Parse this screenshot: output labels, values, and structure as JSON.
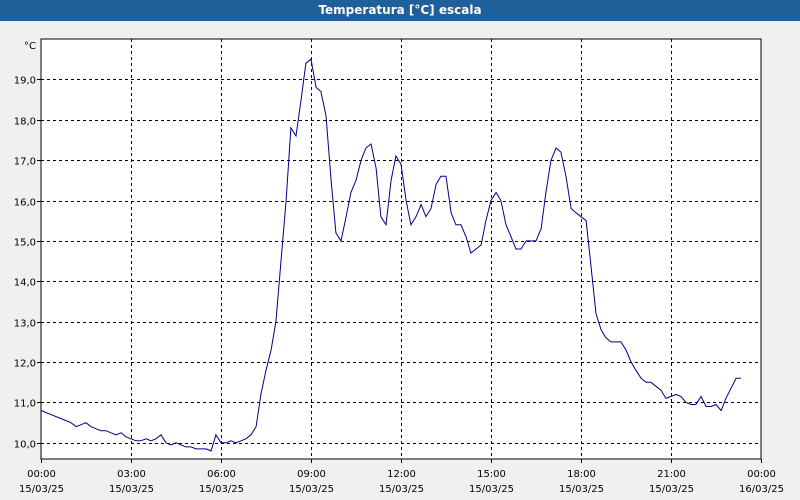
{
  "window": {
    "title": "Temperatura [°C] escala"
  },
  "colors": {
    "titlebar": "#1f5f9a",
    "line": "#00008b",
    "grid": "#000000",
    "plot_bg": "#ffffff"
  },
  "chart_data": {
    "type": "line",
    "title": "Temperatura [°C] escala",
    "ylabel": "°C",
    "xlabel": "",
    "ylim": [
      9.6,
      20.0
    ],
    "grid": true,
    "x_ticks": [
      {
        "hours": 0,
        "time": "00:00",
        "date": "15/03/25"
      },
      {
        "hours": 3,
        "time": "03:00",
        "date": "15/03/25"
      },
      {
        "hours": 6,
        "time": "06:00",
        "date": "15/03/25"
      },
      {
        "hours": 9,
        "time": "09:00",
        "date": "15/03/25"
      },
      {
        "hours": 12,
        "time": "12:00",
        "date": "15/03/25"
      },
      {
        "hours": 15,
        "time": "15:00",
        "date": "15/03/25"
      },
      {
        "hours": 18,
        "time": "18:00",
        "date": "15/03/25"
      },
      {
        "hours": 21,
        "time": "21:00",
        "date": "15/03/25"
      },
      {
        "hours": 24,
        "time": "00:00",
        "date": "16/03/25"
      }
    ],
    "y_ticks": [
      {
        "value": 10,
        "label": "10,0"
      },
      {
        "value": 11,
        "label": "11,0"
      },
      {
        "value": 12,
        "label": "12,0"
      },
      {
        "value": 13,
        "label": "13,0"
      },
      {
        "value": 14,
        "label": "14,0"
      },
      {
        "value": 15,
        "label": "15,0"
      },
      {
        "value": 16,
        "label": "16,0"
      },
      {
        "value": 17,
        "label": "17,0"
      },
      {
        "value": 18,
        "label": "18,0"
      },
      {
        "value": 19,
        "label": "19,0"
      }
    ],
    "series": [
      {
        "x_hours": [
          0,
          0.33,
          0.67,
          1.0,
          1.17,
          1.33,
          1.5,
          1.67,
          1.83,
          2.0,
          2.17,
          2.33,
          2.5,
          2.67,
          2.83,
          3.0,
          3.17,
          3.33,
          3.5,
          3.67,
          3.83,
          4.0,
          4.17,
          4.33,
          4.5,
          4.67,
          4.83,
          5.0,
          5.17,
          5.33,
          5.5,
          5.67,
          5.83,
          6.0,
          6.17,
          6.33,
          6.5,
          6.67,
          6.83,
          7.0,
          7.17,
          7.33,
          7.5,
          7.67,
          7.83,
          8.0,
          8.17,
          8.33,
          8.5,
          8.67,
          8.83,
          9.0,
          9.17,
          9.33,
          9.5,
          9.67,
          9.83,
          10.0,
          10.17,
          10.33,
          10.5,
          10.67,
          10.83,
          11.0,
          11.17,
          11.33,
          11.5,
          11.67,
          11.83,
          12.0,
          12.17,
          12.33,
          12.5,
          12.67,
          12.83,
          13.0,
          13.17,
          13.33,
          13.5,
          13.67,
          13.83,
          14.0,
          14.17,
          14.33,
          14.5,
          14.67,
          14.83,
          15.0,
          15.17,
          15.33,
          15.5,
          15.67,
          15.83,
          16.0,
          16.17,
          16.33,
          16.5,
          16.67,
          16.83,
          17.0,
          17.17,
          17.33,
          17.5,
          17.67,
          17.83,
          18.0,
          18.17,
          18.33,
          18.5,
          18.67,
          18.83,
          19.0,
          19.17,
          19.33,
          19.5,
          19.67,
          19.83,
          20.0,
          20.17,
          20.33,
          20.5,
          20.67,
          20.83,
          21.0,
          21.17,
          21.33,
          21.5,
          21.67,
          21.83,
          22.0,
          22.17,
          22.33,
          22.5,
          22.67,
          22.83,
          23.0,
          23.17,
          23.33,
          23.5,
          23.67,
          23.83
        ],
        "values": [
          10.8,
          10.7,
          10.6,
          10.5,
          10.4,
          10.45,
          10.5,
          10.4,
          10.35,
          10.3,
          10.3,
          10.25,
          10.2,
          10.25,
          10.15,
          10.1,
          10.05,
          10.05,
          10.1,
          10.05,
          10.1,
          10.2,
          10.0,
          9.95,
          10.0,
          9.95,
          9.9,
          9.9,
          9.85,
          9.85,
          9.85,
          9.8,
          10.2,
          10.0,
          10.0,
          10.05,
          10.0,
          10.05,
          10.1,
          10.2,
          10.4,
          11.2,
          11.8,
          12.3,
          13.0,
          14.5,
          16.0,
          17.8,
          17.6,
          18.5,
          19.4,
          19.5,
          18.8,
          18.7,
          18.1,
          16.5,
          15.2,
          15.0,
          15.6,
          16.2,
          16.5,
          17.0,
          17.3,
          17.4,
          16.8,
          15.6,
          15.4,
          16.5,
          17.1,
          16.9,
          16.0,
          15.4,
          15.6,
          15.9,
          15.6,
          15.8,
          16.4,
          16.6,
          16.6,
          15.7,
          15.4,
          15.4,
          15.1,
          14.7,
          14.8,
          14.9,
          15.5,
          16.0,
          16.2,
          16.0,
          15.4,
          15.1,
          14.8,
          14.8,
          15.0,
          15.0,
          15.0,
          15.3,
          16.2,
          17.0,
          17.3,
          17.2,
          16.6,
          15.8,
          15.7,
          15.6,
          15.5,
          14.4,
          13.2,
          12.8,
          12.6,
          12.5,
          12.5,
          12.5,
          12.3,
          12.0,
          11.8,
          11.6,
          11.5,
          11.5,
          11.4,
          11.3,
          11.1,
          11.15,
          11.2,
          11.15,
          11.0,
          10.95,
          10.95,
          11.15,
          10.9,
          10.9,
          10.95,
          10.8,
          11.1,
          11.35,
          11.6,
          11.6
        ]
      }
    ]
  }
}
